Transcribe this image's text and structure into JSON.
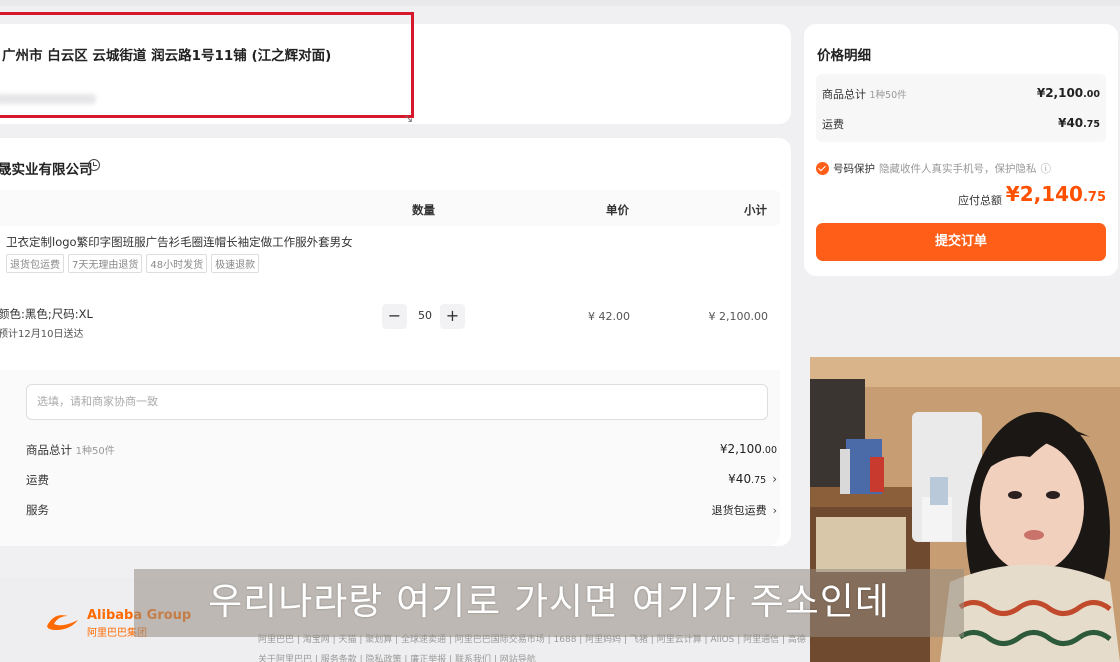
{
  "address": {
    "line": "广州市 白云区 云城街道 润云路1号11铺 (江之辉对面)"
  },
  "shop": {
    "name": "晟实业有限公司"
  },
  "table_headers": {
    "qty": "数量",
    "unit_price": "单价",
    "subtotal": "小计"
  },
  "product": {
    "title": "卫衣定制logo繁印字图班服广告衫毛圈连帽长袖定做工作服外套男女",
    "tags": [
      "退货包运费",
      "7天无理由退货",
      "48小时发货",
      "极速退款"
    ],
    "variant": "颜色:黑色;尺码:XL",
    "delivery": "预计12月10日送达",
    "quantity": "50",
    "unit_price": "¥ 42.00",
    "subtotal": "¥ 2,100.00"
  },
  "remark_placeholder": "选填，请和商家协商一致",
  "summary": {
    "goods_label": "商品总计",
    "goods_sub": "1种50件",
    "goods_val_main": "¥2,100",
    "goods_val_dec": ".00",
    "shipping_label": "运费",
    "shipping_val_main": "¥40",
    "shipping_val_dec": ".75",
    "service_label": "服务",
    "service_val": "退货包运费"
  },
  "price_detail": {
    "title": "价格明细",
    "goods_label": "商品总计",
    "goods_sub": "1种50件",
    "goods_val_main": "¥2,100",
    "goods_val_dec": ".00",
    "shipping_label": "运费",
    "shipping_val_main": "¥40",
    "shipping_val_dec": ".75",
    "protect_label": "号码保护",
    "protect_hint": "隐藏收件人真实手机号，保护隐私",
    "total_label": "应付总额",
    "total_main": "¥2,140",
    "total_dec": ".75",
    "submit": "提交订单"
  },
  "footer": {
    "logo_en": "Alibaba Group",
    "logo_cn": "阿里巴巴集团",
    "links": "阿里巴巴 | 淘宝网 | 天猫 | 聚划算 | 全球速卖通 | 阿里巴巴国际交易市场 | 1688 | 阿里妈妈 | 飞猪 | 阿里云计算 | AliOS | 阿里通信 | 高德 | UC | 友盟 | 虾米 | 阿里星球 | 钉钉 | 支付宝 | 达摩院 | 淘宝海外",
    "links2": "关于阿里巴巴 | 服务条款 | 隐私政策 | 廉正举报 | 联系我们 | 网站导航"
  },
  "subtitle": "우리나라랑 여기로 가시면 여기가 주소인데",
  "colors": {
    "accent": "#ff5e18",
    "price_red": "#ff5000",
    "highlight_box": "#d7172b"
  }
}
